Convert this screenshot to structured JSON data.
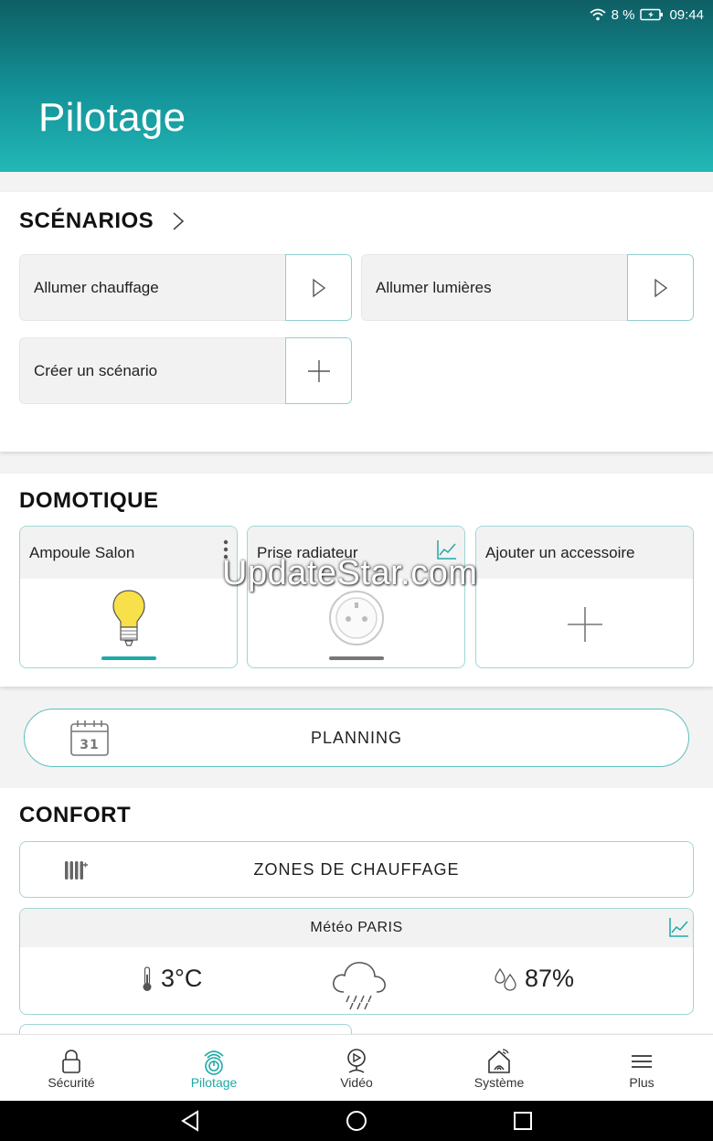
{
  "status": {
    "battery": "8 %",
    "time": "09:44"
  },
  "header": {
    "title": "Pilotage"
  },
  "scenarios": {
    "title": "SCÉNARIOS",
    "items": [
      {
        "label": "Allumer chauffage",
        "action_icon": "play-icon"
      },
      {
        "label": "Allumer lumières",
        "action_icon": "play-icon"
      },
      {
        "label": "Créer un scénario",
        "action_icon": "plus-icon"
      }
    ]
  },
  "domotique": {
    "title": "DOMOTIQUE",
    "devices": [
      {
        "label": "Ampoule Salon",
        "icon": "bulb-icon",
        "state": "on"
      },
      {
        "label": "Prise radiateur",
        "icon": "socket-icon",
        "state": "off"
      },
      {
        "label": "Ajouter un accessoire",
        "icon": "plus-icon"
      }
    ]
  },
  "watermark": "UpdateStar.com",
  "planning": {
    "label": "PLANNING",
    "calendar_day": "31"
  },
  "confort": {
    "title": "CONFORT",
    "zones_label": "ZONES DE CHAUFFAGE",
    "meteo": {
      "title": "Météo PARIS",
      "temperature": "3°C",
      "weather_icon": "rain-cloud-icon",
      "humidity": "87%"
    }
  },
  "nav": [
    {
      "label": "Sécurité",
      "icon": "lock-icon"
    },
    {
      "label": "Pilotage",
      "icon": "pilotage-icon",
      "active": true
    },
    {
      "label": "Vidéo",
      "icon": "camera-icon"
    },
    {
      "label": "Système",
      "icon": "home-network-icon"
    },
    {
      "label": "Plus",
      "icon": "menu-icon"
    }
  ],
  "colors": {
    "accent": "#1fa9a7",
    "bulb": "#f7e04a",
    "header_top": "#0e5f64",
    "header_bottom": "#22b7b6"
  }
}
